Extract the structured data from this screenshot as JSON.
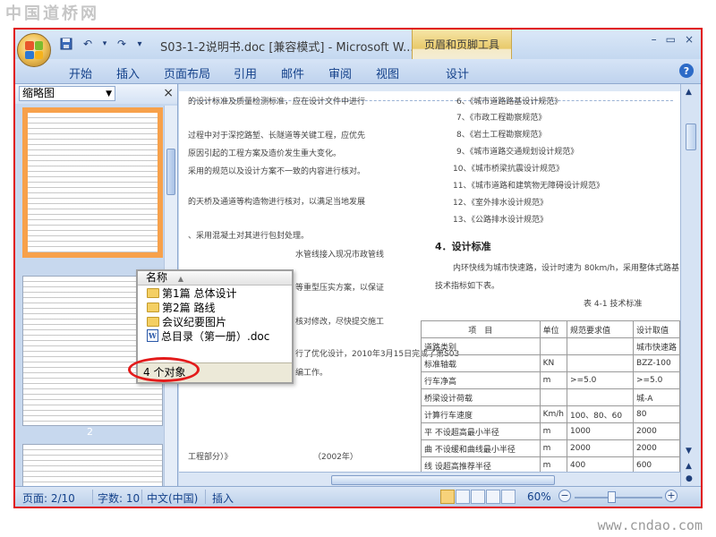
{
  "watermark": {
    "top_left": "中国道桥网",
    "bottom_right": "www.cndao.com"
  },
  "window": {
    "title": "S03-1-2说明书.doc [兼容模式] - Microsoft W...",
    "context_tab_group": "页眉和页脚工具",
    "controls": {
      "minimize": "–",
      "restore": "▭",
      "close": "×"
    }
  },
  "quick_access": {
    "undo": "↶",
    "dropdown": "▾",
    "redo": "↷",
    "customize": "▾"
  },
  "ribbon_tabs": [
    "开始",
    "插入",
    "页面布局",
    "引用",
    "邮件",
    "审阅",
    "视图",
    "设计"
  ],
  "help": "?",
  "nav_pane": {
    "view_label": "缩略图",
    "close": "×",
    "page_number": "2"
  },
  "document": {
    "left_column": [
      "的设计标准及质量检测标准，应在设计文件中进行",
      "过程中对于深挖路堑、长隧道等关键工程，应优先",
      "原因引起的工程方案及造价发生重大变化。",
      "采用的规范以及设计方案不一致的内容进行核对。",
      "的天桥及通道等构造物进行核对，以满足当地发展",
      "、采用混凝土对其进行包封处理。",
      "水管线接入现况市政管线",
      "等重型压实方案，以保证",
      "核对修改，尽快提交施工",
      "行了优化设计，2010年3月15日完成了第S03",
      "编工作。",
      "工程部分）》",
      "（2002年）"
    ],
    "right_list": [
      "6、《城市道路路基设计规范》",
      "7、《市政工程勘察规范》",
      "8、《岩土工程勘察规范》",
      "9、《城市道路交通规划设计规范》",
      "10、《城市桥梁抗震设计规范》",
      "11、《城市道路和建筑物无障碍设计规范》",
      "12、《室外排水设计规范》",
      "13、《公路排水设计规范》"
    ],
    "section_heading": "4．设计标准",
    "section_para_1": "内环快线为城市快速路，设计时速为 80km/h，采用整体式路基",
    "section_para_2": "技术指标如下表。",
    "table_caption": "表 4-1 技术标准",
    "table_header": [
      "项　目",
      "单位",
      "规范要求值",
      "设计取值"
    ],
    "table_rows": [
      [
        "道路类别",
        "",
        "",
        "城市快速路"
      ],
      [
        "标准轴载",
        "KN",
        "",
        "BZZ-100"
      ],
      [
        "行车净高",
        "m",
        ">=5.0",
        ">=5.0"
      ],
      [
        "桥梁设计荷载",
        "",
        "",
        "城-A"
      ],
      [
        "计算行车速度",
        "Km/h",
        "100、80、60",
        "80"
      ],
      [
        "平 不设超高最小半径",
        "m",
        "1000",
        "2000"
      ],
      [
        "曲 不设缓和曲线最小半径",
        "m",
        "2000",
        "2000"
      ],
      [
        "线 设超高推荐半径",
        "m",
        "400",
        "600"
      ]
    ]
  },
  "explorer_popup": {
    "column_header": "名称",
    "items": [
      {
        "name": "第1篇  总体设计",
        "icon": "folder-icon"
      },
      {
        "name": "第2篇  路线",
        "icon": "folder-icon"
      },
      {
        "name": "会议纪要图片",
        "icon": "folder-icon"
      },
      {
        "name": "总目录（第一册）.doc",
        "icon": "word-doc-icon"
      }
    ],
    "status": "4 个对象"
  },
  "statusbar": {
    "page": "页面: 2/10",
    "words": "字数: 10",
    "language": "中文(中国)",
    "mode": "插入",
    "zoom": "60%",
    "zoom_minus": "−",
    "zoom_plus": "+"
  },
  "colors": {
    "highlight": "#e31b1b",
    "office_blue": "#15428b",
    "context_tab": "#e8c96a"
  }
}
